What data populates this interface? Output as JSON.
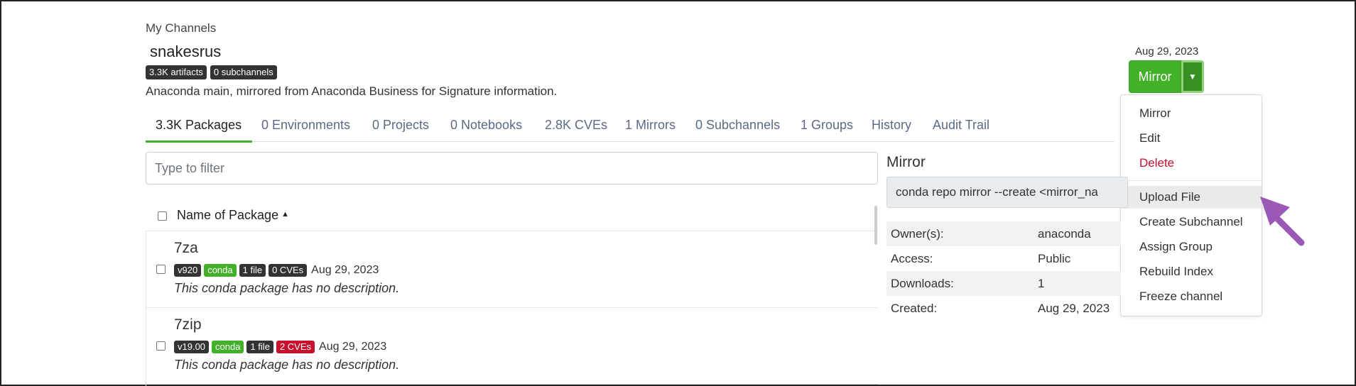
{
  "breadcrumb": "My Channels",
  "channel": {
    "name": "snakesrus",
    "chips": [
      "3.3K artifacts",
      "0 subchannels"
    ],
    "description": "Anaconda main, mirrored from Anaconda Business for Signature information.",
    "date": "Aug 29, 2023"
  },
  "action_button": {
    "label": "Mirror",
    "caret_icon": "caret-down-icon"
  },
  "menu": {
    "items": [
      "Mirror",
      "Edit",
      "Delete",
      "Upload File",
      "Create Subchannel",
      "Assign Group",
      "Rebuild Index",
      "Freeze channel"
    ],
    "highlighted": "Upload File"
  },
  "tabs": [
    "3.3K Packages",
    "0 Environments",
    "0 Projects",
    "0 Notebooks",
    "2.8K CVEs",
    "1 Mirrors",
    "0 Subchannels",
    "1 Groups",
    "History",
    "Audit Trail"
  ],
  "active_tab": "3.3K Packages",
  "filter": {
    "placeholder": "Type to filter"
  },
  "list_header": "Name of Package",
  "packages": [
    {
      "name": "7za",
      "version": "v920",
      "type": "conda",
      "files": "1 file",
      "cves": "0 CVEs",
      "date": "Aug 29, 2023",
      "description": "This conda package has no description."
    },
    {
      "name": "7zip",
      "version": "v19.00",
      "type": "conda",
      "files": "1 file",
      "cves": "2 CVEs",
      "date": "Aug 29, 2023",
      "description": "This conda package has no description."
    }
  ],
  "mirror_panel": {
    "title": "Mirror",
    "command": "conda repo mirror --create <mirror_na",
    "fields": [
      {
        "key": "Owner(s):",
        "value": "anaconda"
      },
      {
        "key": "Access:",
        "value": "Public"
      },
      {
        "key": "Downloads:",
        "value": "1"
      },
      {
        "key": "Created:",
        "value": "Aug 29, 2023"
      }
    ]
  },
  "colors": {
    "green": "#43b02a",
    "red": "#c8102e",
    "dark_badge": "#333333",
    "arrow": "#9b59b6"
  }
}
